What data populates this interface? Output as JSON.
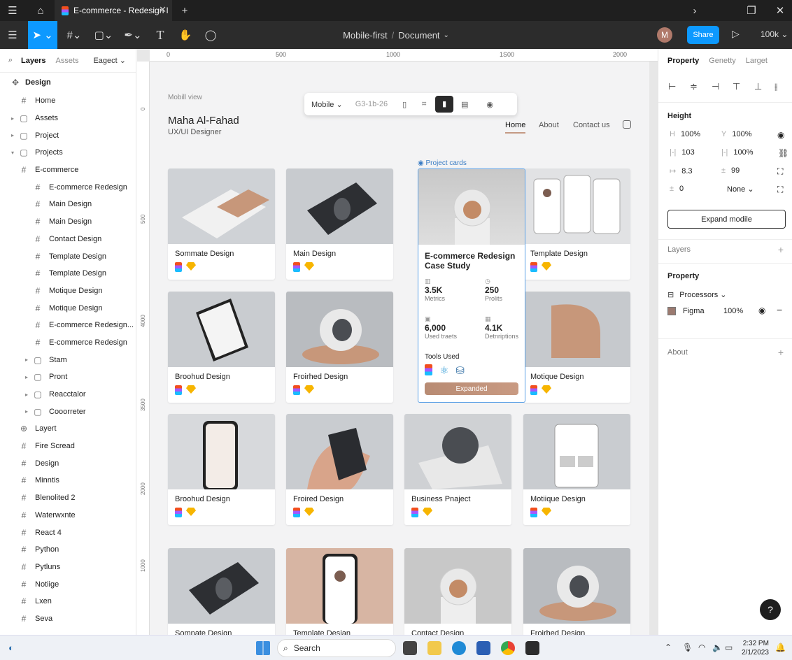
{
  "tab": {
    "title": "E-commerce - Redesign l"
  },
  "doc": {
    "name": "Mobile-first",
    "sep": "/",
    "page": "Document"
  },
  "toolbar": {
    "share": "Share",
    "zoom": "100k",
    "avatar": "M"
  },
  "left_panel": {
    "tabs": [
      "Layers",
      "Assets"
    ],
    "page_select": "Eagect",
    "root": "Design",
    "items": [
      {
        "label": "Home",
        "indent": 1,
        "caret": "",
        "icon": "#"
      },
      {
        "label": "Assets",
        "indent": 1,
        "caret": "▸",
        "icon": "▢"
      },
      {
        "label": "Project",
        "indent": 1,
        "caret": "▸",
        "icon": "▢"
      },
      {
        "label": "Projects",
        "indent": 1,
        "caret": "▾",
        "icon": "▢"
      },
      {
        "label": "E-commerce",
        "indent": 1,
        "caret": "",
        "icon": "#"
      },
      {
        "label": "E-commerce Redesign",
        "indent": 2,
        "caret": "",
        "icon": "#"
      },
      {
        "label": "Main Design",
        "indent": 2,
        "caret": "",
        "icon": "#"
      },
      {
        "label": "Main Design",
        "indent": 2,
        "caret": "",
        "icon": "#"
      },
      {
        "label": "Contact Design",
        "indent": 2,
        "caret": "",
        "icon": "#"
      },
      {
        "label": "Template Design",
        "indent": 2,
        "caret": "",
        "icon": "#"
      },
      {
        "label": "Template Design",
        "indent": 2,
        "caret": "",
        "icon": "#"
      },
      {
        "label": "Motique Design",
        "indent": 2,
        "caret": "",
        "icon": "#"
      },
      {
        "label": "Motique Design",
        "indent": 2,
        "caret": "",
        "icon": "#"
      },
      {
        "label": "E-commerce Redesign...",
        "indent": 2,
        "caret": "",
        "icon": "#"
      },
      {
        "label": "E-commerce Redesign",
        "indent": 2,
        "caret": "",
        "icon": "#"
      },
      {
        "label": "Stam",
        "indent": 2,
        "caret": "▸",
        "icon": "▢"
      },
      {
        "label": "Pront",
        "indent": 2,
        "caret": "▸",
        "icon": "▢"
      },
      {
        "label": "Reacctalor",
        "indent": 2,
        "caret": "▸",
        "icon": "▢"
      },
      {
        "label": "Cooorreter",
        "indent": 2,
        "caret": "▸",
        "icon": "▢"
      },
      {
        "label": "Layert",
        "indent": 1,
        "caret": "",
        "icon": "⊕"
      },
      {
        "label": "Fire Scread",
        "indent": 1,
        "caret": "",
        "icon": "#"
      },
      {
        "label": "Design",
        "indent": 1,
        "caret": "",
        "icon": "#"
      },
      {
        "label": "Minntis",
        "indent": 1,
        "caret": "",
        "icon": "#"
      },
      {
        "label": "Blenolited 2",
        "indent": 1,
        "caret": "",
        "icon": "#"
      },
      {
        "label": "Waterwxnte",
        "indent": 1,
        "caret": "",
        "icon": "#"
      },
      {
        "label": "React 4",
        "indent": 1,
        "caret": "",
        "icon": "#"
      },
      {
        "label": "Python",
        "indent": 1,
        "caret": "",
        "icon": "#"
      },
      {
        "label": "Pytluns",
        "indent": 1,
        "caret": "",
        "icon": "#"
      },
      {
        "label": "Notiige",
        "indent": 1,
        "caret": "",
        "icon": "#"
      },
      {
        "label": "Lxen",
        "indent": 1,
        "caret": "",
        "icon": "#"
      },
      {
        "label": "Seva",
        "indent": 1,
        "caret": "",
        "icon": "#"
      }
    ]
  },
  "ruler": {
    "h": [
      "0",
      "500",
      "1000",
      "1S00",
      "2000"
    ],
    "v": [
      "0",
      "500",
      "4000",
      "3500",
      "2000",
      "1000"
    ]
  },
  "canvas": {
    "frame_label": "Mobill view",
    "owner": "Maha Al-Fahad",
    "role": "UX/UI Designer",
    "nav": [
      "Home",
      "About",
      "Contact us"
    ],
    "float": {
      "device": "Mobile",
      "coords": "G3-1b-26"
    },
    "selection_label": "Project cards",
    "cards": [
      {
        "title": "Sommate Design"
      },
      {
        "title": "Main Design"
      },
      {
        "title": "Template Design"
      },
      {
        "title": "Broohud Design"
      },
      {
        "title": "Froirhed Design"
      },
      {
        "title": "Motique Design"
      },
      {
        "title": "Broohud Design"
      },
      {
        "title": "Froired Design"
      },
      {
        "title": "Business Pnaject"
      },
      {
        "title": "Motiique Design"
      },
      {
        "title": "Somnate Design"
      },
      {
        "title": "Template Desian"
      },
      {
        "title": "Contact Design"
      },
      {
        "title": "Froirhed Design"
      }
    ],
    "featured": {
      "title": "E-commerce Redesign Case Study",
      "metrics": [
        {
          "value": "3.5K",
          "label": "Metrics"
        },
        {
          "value": "250",
          "label": "Prolits"
        },
        {
          "value": "6,000",
          "label": "Used traets"
        },
        {
          "value": "4.1K",
          "label": "Detnriptions"
        }
      ],
      "tools_label": "Tools Used",
      "button": "Expanded"
    }
  },
  "right_panel": {
    "tabs": [
      "Property",
      "Genetty",
      "Larget"
    ],
    "height_title": "Height",
    "fields": [
      {
        "k": "H",
        "v": "100%",
        "k2": "Y",
        "v2": "100%"
      },
      {
        "k": "|-|",
        "v": "103",
        "k2": "|-|",
        "v2": "100%"
      },
      {
        "k": "↦",
        "v": "8.3",
        "k2": "±",
        "v2": "99"
      },
      {
        "k": "±",
        "v": "0",
        "k2": "",
        "v2": "None ⌄"
      }
    ],
    "expand_button": "Expand modile",
    "layers": "Layers",
    "property": "Property",
    "processors": "Processors ⌄",
    "fill": {
      "name": "Figma",
      "value": "100%",
      "color": "#9b7a70"
    },
    "about": "About"
  },
  "taskbar": {
    "search": "Search",
    "time": "2:32 PM",
    "date": "2/1/2023"
  },
  "colors": {
    "accent": "#0d99ff",
    "selection": "#5aa0e6",
    "button": "#c09078"
  }
}
